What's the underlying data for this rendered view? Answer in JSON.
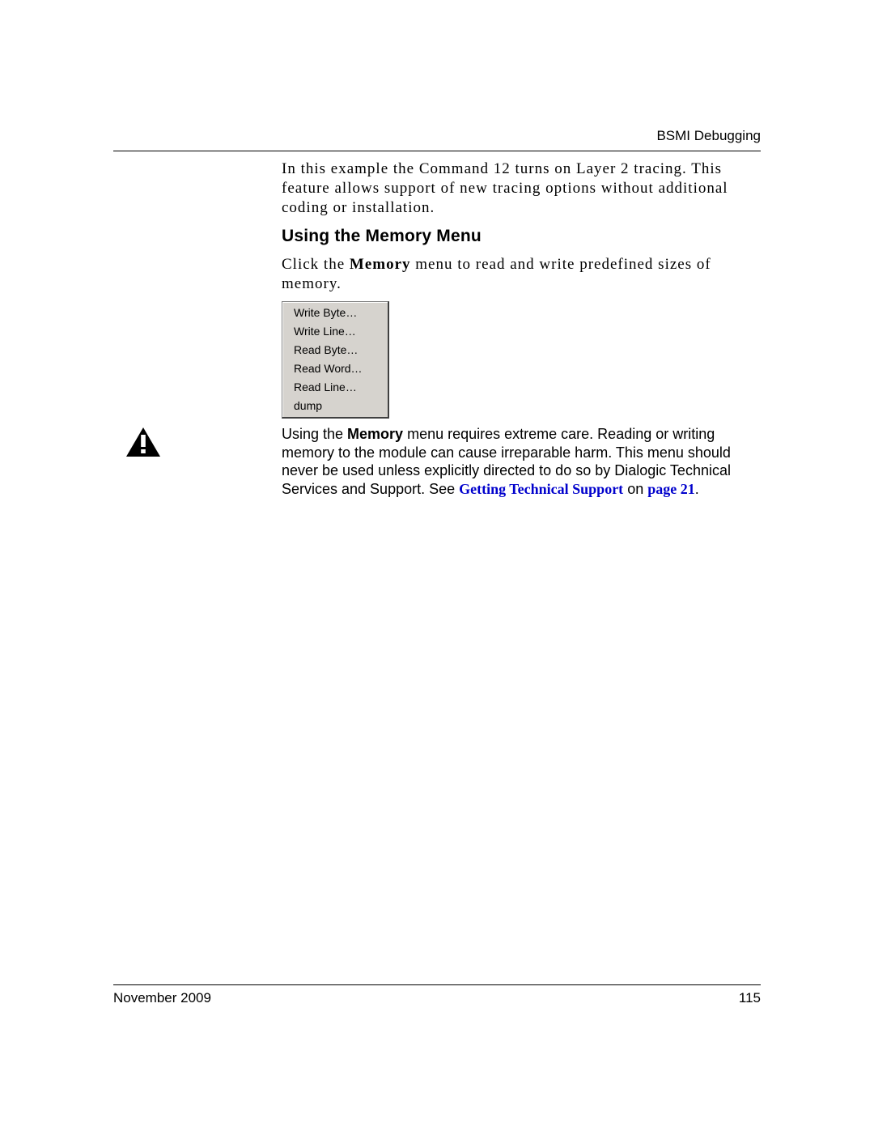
{
  "header": {
    "title": "BSMI Debugging"
  },
  "intro": {
    "text": "In this example the Command 12 turns on Layer 2 tracing. This feature allows support of new tracing options without additional coding or installation."
  },
  "section": {
    "heading": "Using the Memory Menu",
    "para_prefix": "Click the ",
    "para_bold": "Memory",
    "para_suffix": " menu to read and write predefined sizes of memory."
  },
  "menu": {
    "items": [
      "Write Byte…",
      "Write Line…",
      "Read Byte…",
      "Read Word…",
      "Read Line…",
      "dump"
    ]
  },
  "warning": {
    "p1_a": "Using the ",
    "p1_bold": "Memory",
    "p1_b": " menu requires extreme care. Reading or writing memory to the module can cause irreparable harm. This menu should never be used unless explicitly directed to do so by Dialogic Technical Services and Support. See ",
    "link_text": "Getting Technical Support",
    "p1_mid": " on ",
    "page_ref": "page 21",
    "p1_end": "."
  },
  "footer": {
    "date": "November 2009",
    "page": "115"
  }
}
